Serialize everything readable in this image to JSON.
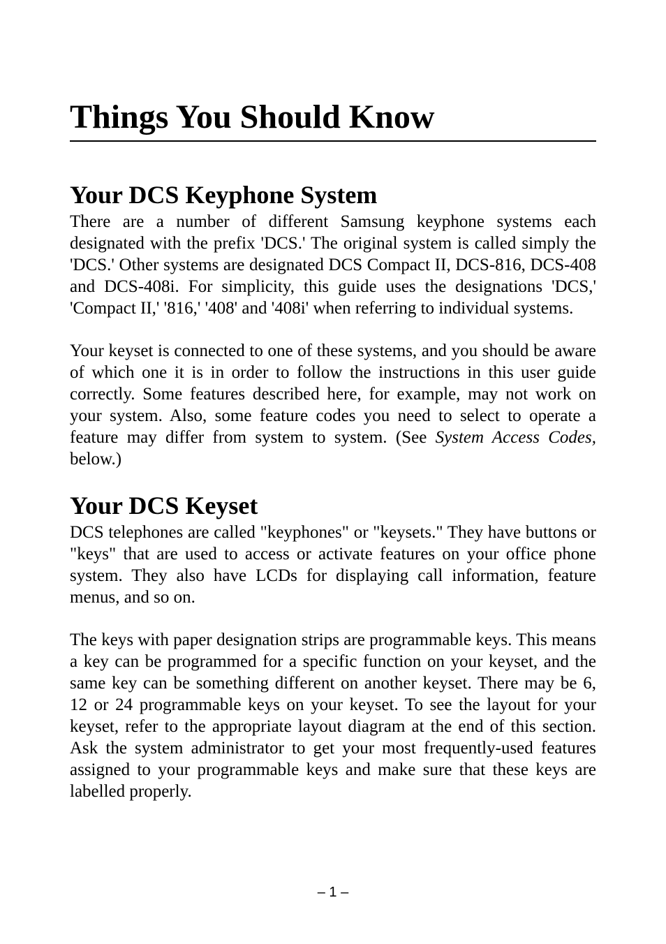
{
  "title": "Things You Should Know",
  "sections": [
    {
      "heading": "Your DCS Keyphone System",
      "paragraphs": [
        {
          "text": "There are a number of different Samsung keyphone systems each designated with the prefix 'DCS.' The original system is called simply the 'DCS.' Other systems are designated DCS Compact II, DCS-816, DCS-408 and DCS-408i. For simplicity, this guide uses the designations 'DCS,' 'Compact II,' '816,' '408' and '408i' when referring to individual systems."
        },
        {
          "text_before_italic": "Your keyset is connected to one of these systems, and you should be aware of which one it is in order to follow the instructions in this user guide correctly. Some features described here, for example, may not work on your system. Also, some feature codes you need to select to operate a feature may differ from system to system. (See ",
          "italic": "System Access Codes,",
          "text_after_italic": " below.)"
        }
      ]
    },
    {
      "heading": "Your DCS Keyset",
      "paragraphs": [
        {
          "text_before_sc": "DCS telephones are called \"keyphones\" or \"keysets.\" They have buttons or \"keys\" that are used to access or activate features on your office phone system. They also have ",
          "smallcaps": "LCDs",
          "text_after_sc": " for displaying call information, feature menus, and so on."
        },
        {
          "text": "The keys with paper designation strips are programmable keys. This means a key can be programmed for a specific function on your keyset, and the same key can be something different on another keyset. There may be 6, 12 or 24 programmable keys on your keyset. To see the layout for your keyset, refer to the appropriate layout diagram at the end of this section. Ask the system administrator to get your most frequently-used features assigned to your programmable keys and make sure that these keys are labelled properly."
        }
      ]
    }
  ],
  "page_number": "– 1 –"
}
